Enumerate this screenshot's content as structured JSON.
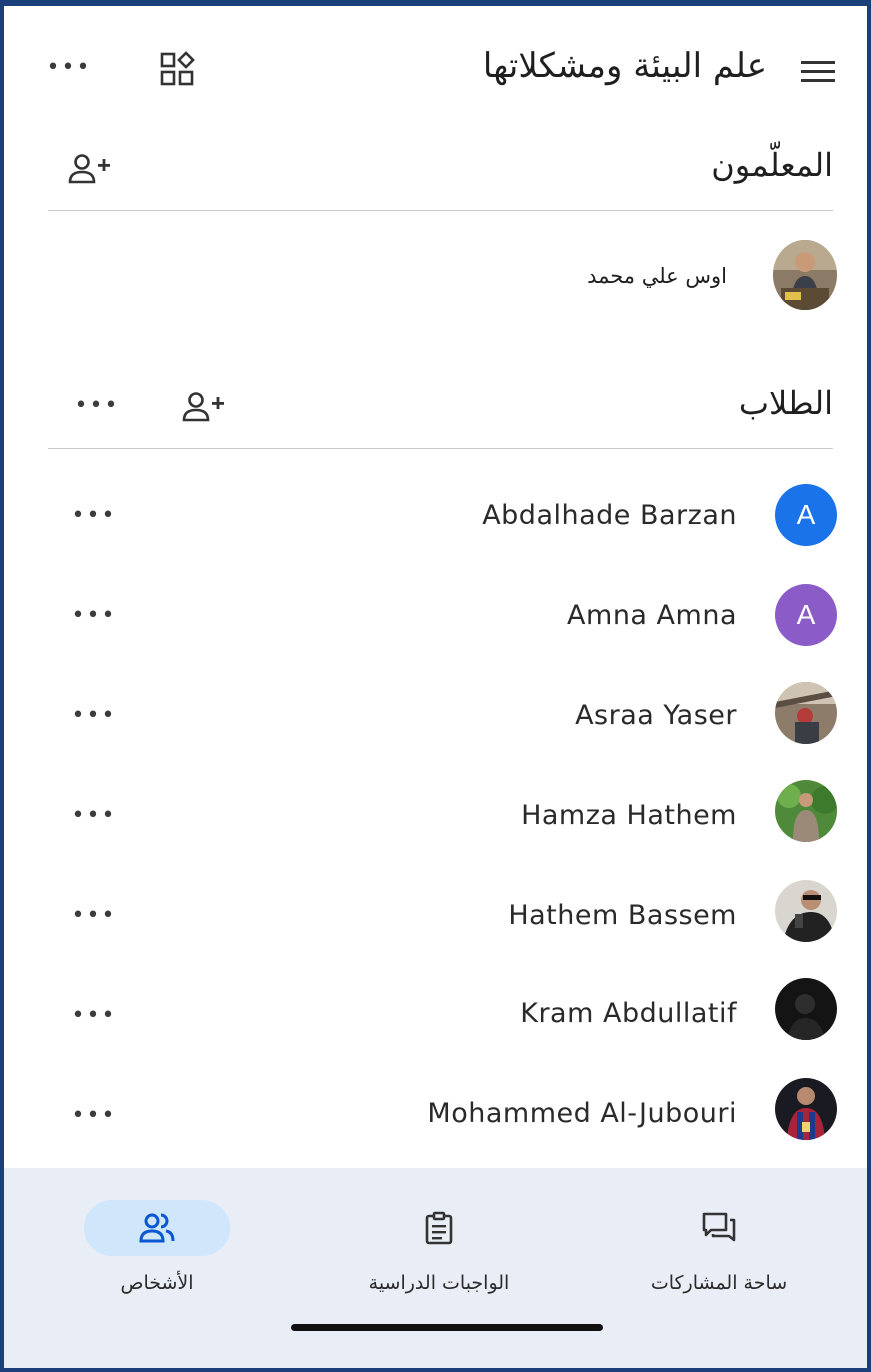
{
  "header": {
    "title": "علم البيئة ومشكلاتها",
    "menu_icon": "hamburger-menu-icon",
    "apps_icon": "apps-grid-icon",
    "more_icon": "more-horizontal-icon"
  },
  "teachers": {
    "title": "المعلّمون",
    "add_icon": "person-add-icon",
    "list": [
      {
        "name": "اوس علي محمد",
        "avatar": "photo"
      }
    ]
  },
  "students": {
    "title": "الطلاب",
    "add_icon": "person-add-icon",
    "list": [
      {
        "name": "Abdalhade Barzan",
        "avatar_letter": "A",
        "avatar_color": "#1a73e8"
      },
      {
        "name": "Amna Amna",
        "avatar_letter": "A",
        "avatar_color": "#8b5cc8"
      },
      {
        "name": "Asraa Yaser",
        "avatar": "photo"
      },
      {
        "name": "Hamza Hathem",
        "avatar": "photo"
      },
      {
        "name": "Hathem Bassem",
        "avatar": "photo"
      },
      {
        "name": "Kram Abdullatif",
        "avatar": "photo"
      },
      {
        "name": "Mohammed Al-Jubouri",
        "avatar": "photo"
      }
    ]
  },
  "bottom_nav": {
    "items": [
      {
        "label": "الأشخاص",
        "icon": "people-icon",
        "active": true
      },
      {
        "label": "الواجبات الدراسية",
        "icon": "clipboard-icon",
        "active": false
      },
      {
        "label": "ساحة المشاركات",
        "icon": "chat-bubbles-icon",
        "active": false
      }
    ]
  },
  "colors": {
    "frame_border": "#1b3f7a",
    "nav_background": "#e9eef6",
    "active_pill": "#cfe6fb",
    "active_icon": "#0b57d0"
  }
}
